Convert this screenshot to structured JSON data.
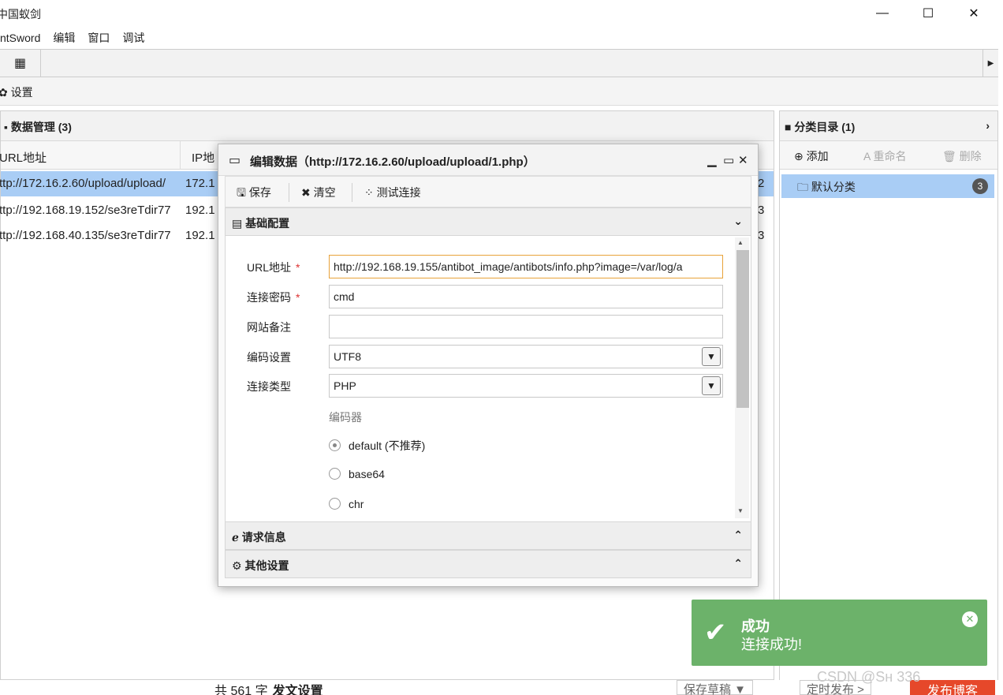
{
  "window": {
    "title": "中国蚁剑",
    "minimize": "—",
    "maximize": "☐",
    "close": "✕"
  },
  "menubar": {
    "items": [
      "ntSword",
      "编辑",
      "窗口",
      "调试"
    ]
  },
  "tabrow": {
    "grid_icon": "▦",
    "arrow": "▶"
  },
  "settings": {
    "label": "✿ 设置"
  },
  "data_panel": {
    "title": "▪ 数据管理 (3)",
    "columns": [
      "URL地址",
      "IP地"
    ],
    "rows": [
      {
        "url": "ttp://172.16.2.60/upload/upload/",
        "ip": "172.1",
        "extra": "2"
      },
      {
        "url": "ttp://192.168.19.152/se3reTdir77",
        "ip": "192.1",
        "extra": "3"
      },
      {
        "url": "ttp://192.168.40.135/se3reTdir77",
        "ip": "192.1",
        "extra": "3"
      }
    ]
  },
  "category_panel": {
    "title": "■ 分类目录 (1)",
    "add": "⊕ 添加",
    "rename": "A 重命名",
    "delete": "🗑 删除",
    "item": "🗀 默认分类",
    "item_count": "3"
  },
  "dialog": {
    "title": "编辑数据（http://172.16.2.60/upload/upload/1.php）",
    "toolbar": {
      "save": "🖫 保存",
      "clear": "✖ 清空",
      "test": "⁘ 测试连接"
    },
    "sections": {
      "basic": "基础配置",
      "request": "请求信息",
      "other": "其他设置"
    },
    "fields": {
      "url_label": "URL地址",
      "url_value": "http://192.168.19.155/antibot_image/antibots/info.php?image=/var/log/a",
      "password_label": "连接密码",
      "password_value": "cmd",
      "note_label": "网站备注",
      "note_value": "",
      "encoding_label": "编码设置",
      "encoding_value": "UTF8",
      "type_label": "连接类型",
      "type_value": "PHP",
      "encoder_label": "编码器",
      "required_mark": "*"
    },
    "encoders": [
      {
        "label": "default (不推荐)",
        "selected": true
      },
      {
        "label": "base64",
        "selected": false
      },
      {
        "label": "chr",
        "selected": false
      }
    ]
  },
  "toast": {
    "title": "成功",
    "message": "连接成功!",
    "color": "#6cb26a"
  },
  "background_page": {
    "word_count": "共 561 字",
    "article_settings": "发文设置",
    "save_draft": "保存草稿 ▼",
    "schedule": "定时发布 >",
    "publish": "发布博客",
    "watermark": "CSDN @Sн     336"
  }
}
